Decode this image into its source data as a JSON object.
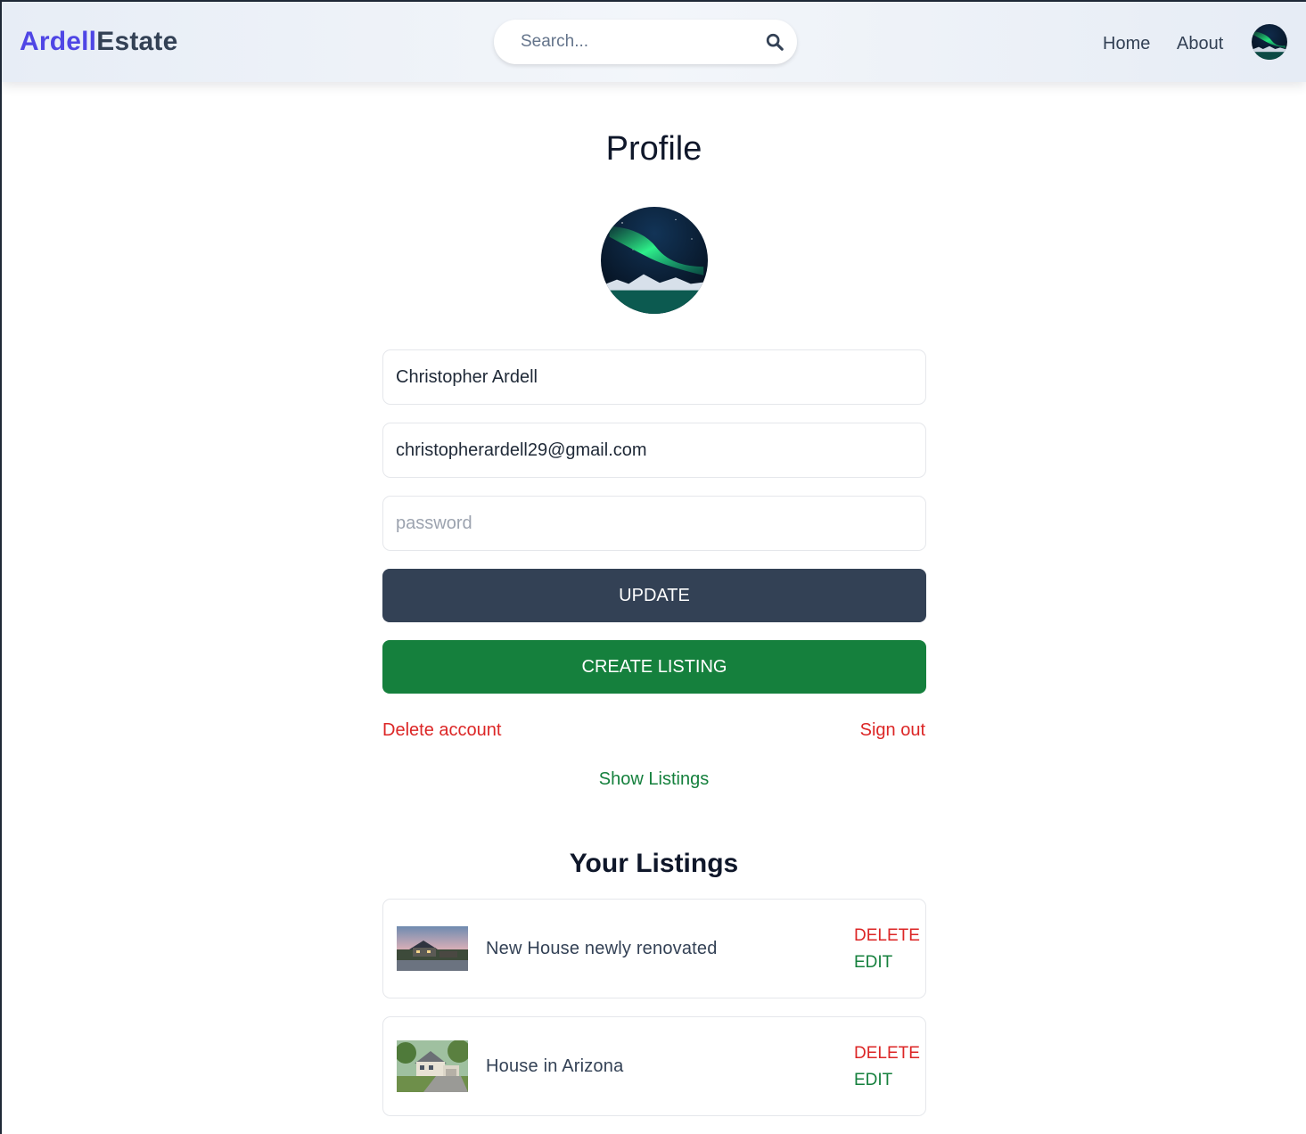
{
  "header": {
    "brand_part1": "Ardell",
    "brand_part2": "Estate",
    "search_placeholder": "Search...",
    "nav": {
      "home": "Home",
      "about": "About"
    }
  },
  "profile": {
    "title": "Profile",
    "name_value": "Christopher Ardell",
    "email_value": "christopherardell29@gmail.com",
    "password_placeholder": "password",
    "update_label": "UPDATE",
    "create_listing_label": "CREATE LISTING",
    "delete_account_label": "Delete account",
    "sign_out_label": "Sign out",
    "show_listings_label": "Show Listings"
  },
  "listings": {
    "title": "Your Listings",
    "items": [
      {
        "name": "New House newly renovated",
        "delete_label": "DELETE",
        "edit_label": "EDIT"
      },
      {
        "name": "House in Arizona",
        "delete_label": "DELETE",
        "edit_label": "EDIT"
      }
    ]
  },
  "colors": {
    "brand_accent": "#4f46e5",
    "brand_dark": "#334155",
    "update_button": "#334155",
    "create_button": "#15803d",
    "danger": "#dc2626",
    "success": "#15803d"
  }
}
